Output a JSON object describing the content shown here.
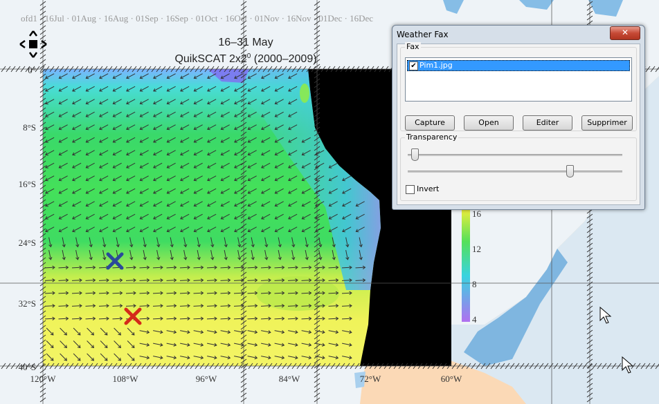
{
  "map": {
    "title_line1": "16–31 May",
    "title_line2_prefix": "QuikSCAT 2x2",
    "title_line2_sup": "0",
    "title_line2_suffix": " (2000–2009)",
    "lat_labels": [
      "0°",
      "8°S",
      "16°S",
      "24°S",
      "32°S",
      "40°S"
    ],
    "lon_labels": [
      "120°W",
      "108°W",
      "96°W",
      "84°W",
      "72°W",
      "60°W"
    ],
    "colorbar_ticks": [
      "16",
      "12",
      "8",
      "4"
    ],
    "markers": [
      {
        "name": "blue-x-marker",
        "color": "#2a4a9a"
      },
      {
        "name": "red-x-marker",
        "color": "#d42a1a"
      }
    ],
    "colors": {
      "ocean_bg": "#dbe8f2",
      "land": "#fbd9b6",
      "sea": "#7fb6e0",
      "mask": "#000000"
    }
  },
  "nav_control": {
    "icon": "pan-arrows-icon"
  },
  "weather_fax": {
    "title": "Weather Fax",
    "close_label": "✕",
    "fax_group_label": "Fax",
    "files": [
      {
        "name": "Pim1.jpg",
        "checked": true,
        "selected": true
      }
    ],
    "buttons": {
      "capture": "Capture",
      "open": "Open",
      "edit": "Editer",
      "delete": "Supprimer"
    },
    "transparency_label": "Transparency",
    "slider1_value": 0.03,
    "slider2_value": 0.75,
    "invert_label": "Invert",
    "invert_checked": false
  }
}
